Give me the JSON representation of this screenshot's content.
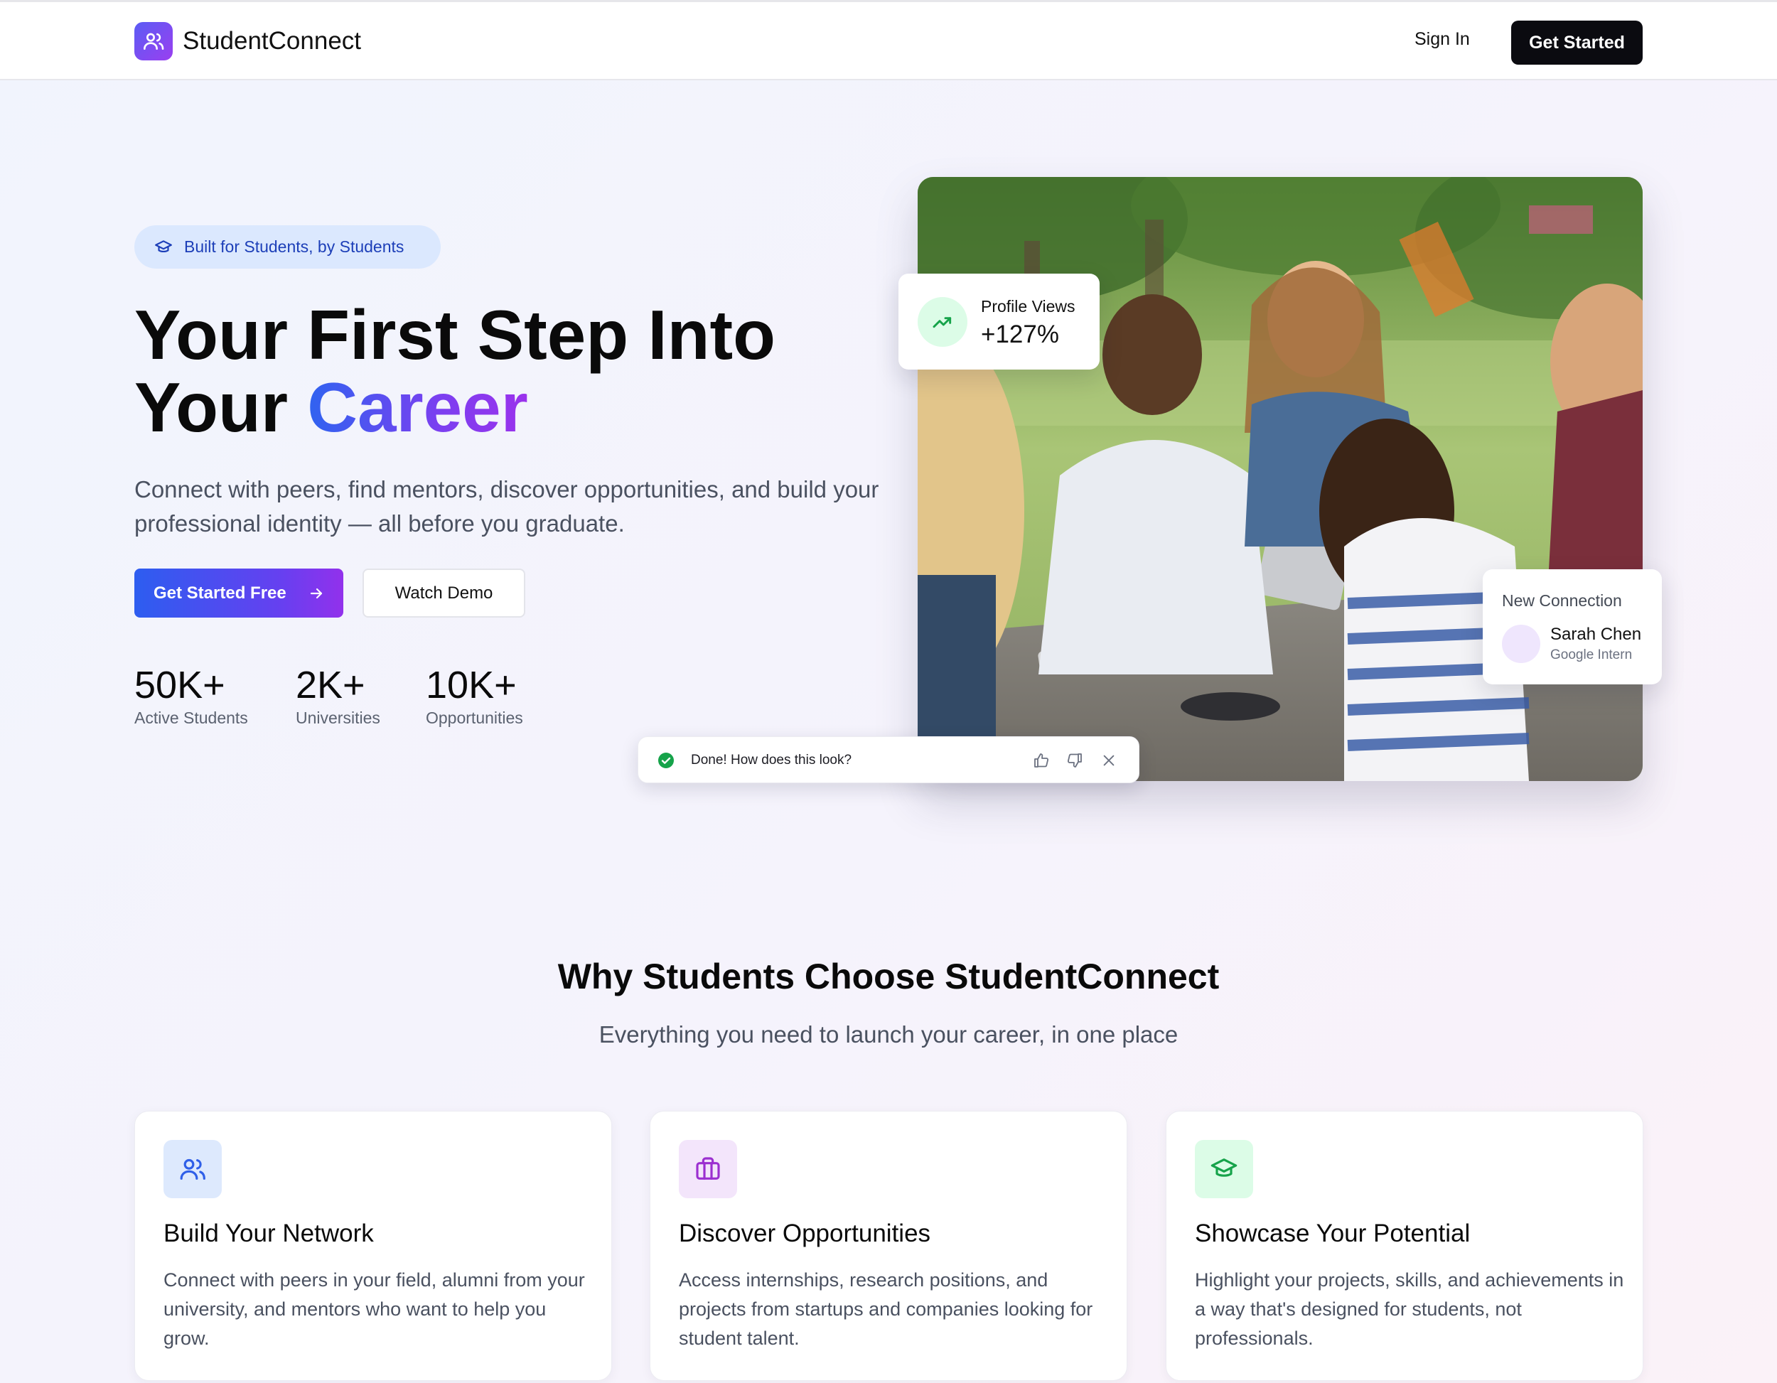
{
  "header": {
    "brand": "StudentConnect",
    "sign_in": "Sign In",
    "get_started": "Get Started"
  },
  "hero": {
    "badge": "Built for Students, by Students",
    "title_line1": "Your First Step Into",
    "title_line2_plain": "Your ",
    "title_line2_accent": "Career",
    "subtitle": "Connect with peers, find mentors, discover opportunities, and build your professional identity — all before you graduate.",
    "primary_cta": "Get Started Free",
    "secondary_cta": "Watch Demo",
    "stats": [
      {
        "value": "50K+",
        "label": "Active Students"
      },
      {
        "value": "2K+",
        "label": "Universities"
      },
      {
        "value": "10K+",
        "label": "Opportunities"
      }
    ]
  },
  "profile_views_card": {
    "label": "Profile Views",
    "value": "+127%"
  },
  "new_connection_card": {
    "title": "New Connection",
    "name": "Sarah Chen",
    "role": "Google Intern"
  },
  "feedback_toast": {
    "message": "Done! How does this look?"
  },
  "features": {
    "title": "Why Students Choose StudentConnect",
    "subtitle": "Everything you need to launch your career, in one place",
    "cards": [
      {
        "icon": "users-icon",
        "title": "Build Your Network",
        "description": "Connect with peers in your field, alumni from your university, and mentors who want to help you grow."
      },
      {
        "icon": "briefcase-icon",
        "title": "Discover Opportunities",
        "description": "Access internships, research positions, and projects from startups and companies looking for student talent."
      },
      {
        "icon": "graduation-cap-icon",
        "title": "Showcase Your Potential",
        "description": "Highlight your projects, skills, and achievements in a way that's designed for students, not professionals."
      }
    ]
  },
  "colors": {
    "brand_gradient_start": "#2d5df0",
    "brand_gradient_end": "#9231ec",
    "primary_dark": "#0b0b10",
    "badge_bg": "#dbe8fe",
    "success_green": "#16a34a"
  }
}
